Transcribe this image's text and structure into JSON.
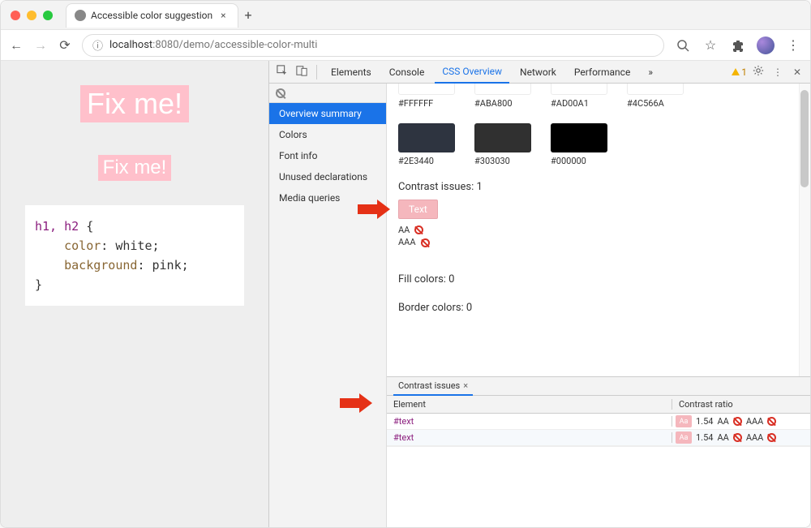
{
  "browser": {
    "tab_title": "Accessible color suggestion",
    "url_host": "localhost",
    "url_port": ":8080",
    "url_path": "/demo/accessible-color-multi"
  },
  "page": {
    "h1": "Fix me!",
    "h2": "Fix me!",
    "code": {
      "selector": "h1, h2",
      "brace_open": " {",
      "line1_prop": "color",
      "line1_val": ": white;",
      "line2_prop": "background",
      "line2_val": ": pink;",
      "brace_close": "}"
    }
  },
  "devtools": {
    "tabs": [
      "Elements",
      "Console",
      "CSS Overview",
      "Network",
      "Performance"
    ],
    "active_tab": "CSS Overview",
    "more_tabs": "»",
    "warn_count": "1",
    "sidenav": [
      "Overview summary",
      "Colors",
      "Font info",
      "Unused declarations",
      "Media queries"
    ],
    "swatches_top": [
      {
        "hex": "#FFFFFF",
        "bg": "#FFFFFF"
      },
      {
        "hex": "#ABA800",
        "bg": "#ABA800"
      },
      {
        "hex": "#AD00A1",
        "bg": "#AD00A1"
      },
      {
        "hex": "#4C566A",
        "bg": "#4C566A"
      }
    ],
    "swatches_dark": [
      {
        "hex": "#2E3440",
        "bg": "#2E3440"
      },
      {
        "hex": "#303030",
        "bg": "#303030"
      },
      {
        "hex": "#000000",
        "bg": "#000000"
      }
    ],
    "contrast_issues_label": "Contrast issues: 1",
    "text_swatch_label": "Text",
    "aa_label": "AA",
    "aaa_label": "AAA",
    "fill_colors_label": "Fill colors: 0",
    "border_colors_label": "Border colors: 0",
    "subtab_label": "Contrast issues",
    "table": {
      "col_element": "Element",
      "col_ratio": "Contrast ratio",
      "rows": [
        {
          "element": "#text",
          "ratio": "1.54",
          "aa": "AA",
          "aaa": "AAA"
        },
        {
          "element": "#text",
          "ratio": "1.54",
          "aa": "AA",
          "aaa": "AAA"
        }
      ]
    }
  }
}
